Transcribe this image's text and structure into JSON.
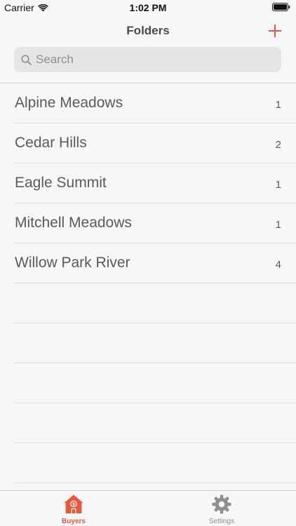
{
  "status_bar": {
    "carrier": "Carrier",
    "time": "1:02 PM"
  },
  "nav": {
    "title": "Folders",
    "add_icon": "plus-icon"
  },
  "search": {
    "placeholder": "Search",
    "value": ""
  },
  "folders": [
    {
      "name": "Alpine Meadows",
      "count": "1"
    },
    {
      "name": "Cedar Hills",
      "count": "2"
    },
    {
      "name": "Eagle Summit",
      "count": "1"
    },
    {
      "name": "Mitchell Meadows",
      "count": "1"
    },
    {
      "name": "Willow Park River",
      "count": "4"
    }
  ],
  "tabs": [
    {
      "label": "Buyers",
      "icon": "house-dollar-icon",
      "selected": true
    },
    {
      "label": "Settings",
      "icon": "gear-icon",
      "selected": false
    }
  ],
  "colors": {
    "accent": "#e8593c",
    "inactive": "#8e8e93",
    "background": "#f7f7f7",
    "search_bg": "#e4e5e6"
  }
}
